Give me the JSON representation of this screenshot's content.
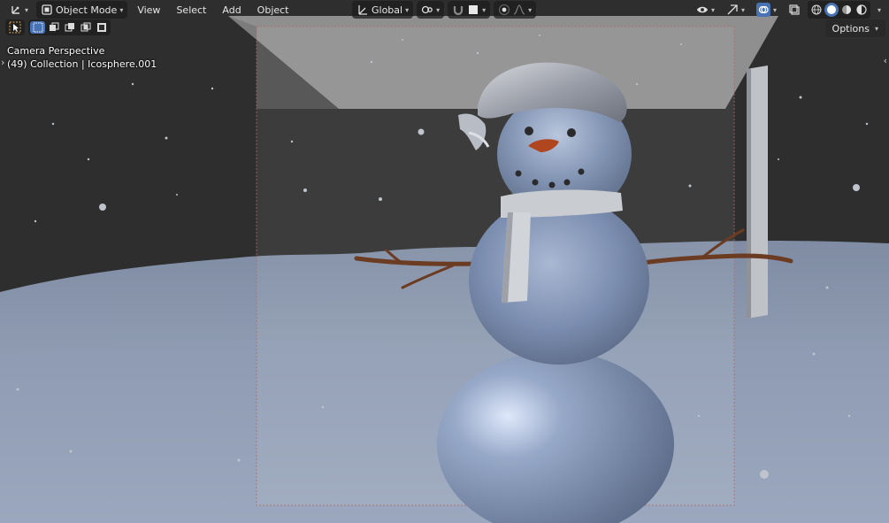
{
  "header": {
    "editor_type_icon": "axes-gizmo-icon",
    "mode_label": "Object Mode",
    "menus": [
      "View",
      "Select",
      "Add",
      "Object"
    ],
    "transform_orientation": "Global"
  },
  "viewport_overlay": {
    "perspective_label": "Camera Perspective",
    "collection_label": "(49) Collection | Icosphere.001"
  },
  "options": {
    "label": "Options"
  },
  "scene": {
    "background_color": "#2d2d2d",
    "snow_color": "#8a99b3",
    "snowman_color": "#7f93b3",
    "scarf_color": "#c9ccd0",
    "hat_color": "#a9adb6",
    "branch_color": "#6b3b22",
    "nose_color": "#b0461f"
  }
}
